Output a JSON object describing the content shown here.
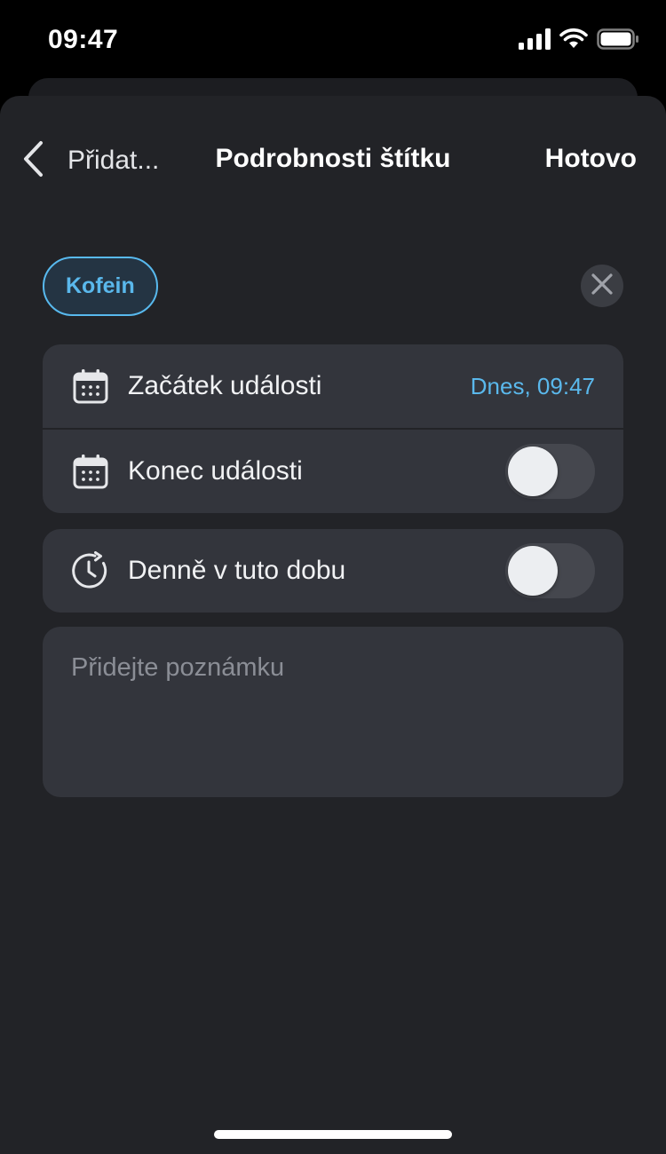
{
  "status_bar": {
    "time": "09:47",
    "icons": [
      "signal-icon",
      "wifi-icon",
      "battery-icon"
    ]
  },
  "nav": {
    "back_label": "Přidat...",
    "title": "Podrobnosti štítku",
    "done_label": "Hotovo"
  },
  "tag": {
    "label": "Kofein",
    "accent": "#5ab8ec"
  },
  "event_card": {
    "start": {
      "icon": "calendar-icon",
      "label": "Začátek události",
      "value": "Dnes, 09:47"
    },
    "end": {
      "icon": "calendar-icon",
      "label": "Konec události",
      "toggle_on": false
    }
  },
  "daily_card": {
    "icon": "clock-repeat-icon",
    "label": "Denně v tuto dobu",
    "toggle_on": false
  },
  "note": {
    "placeholder": "Přidejte poznámku",
    "value": ""
  },
  "colors": {
    "background": "#000000",
    "sheet": "#222327",
    "card": "#33353c",
    "accent": "#5ab8ec"
  }
}
